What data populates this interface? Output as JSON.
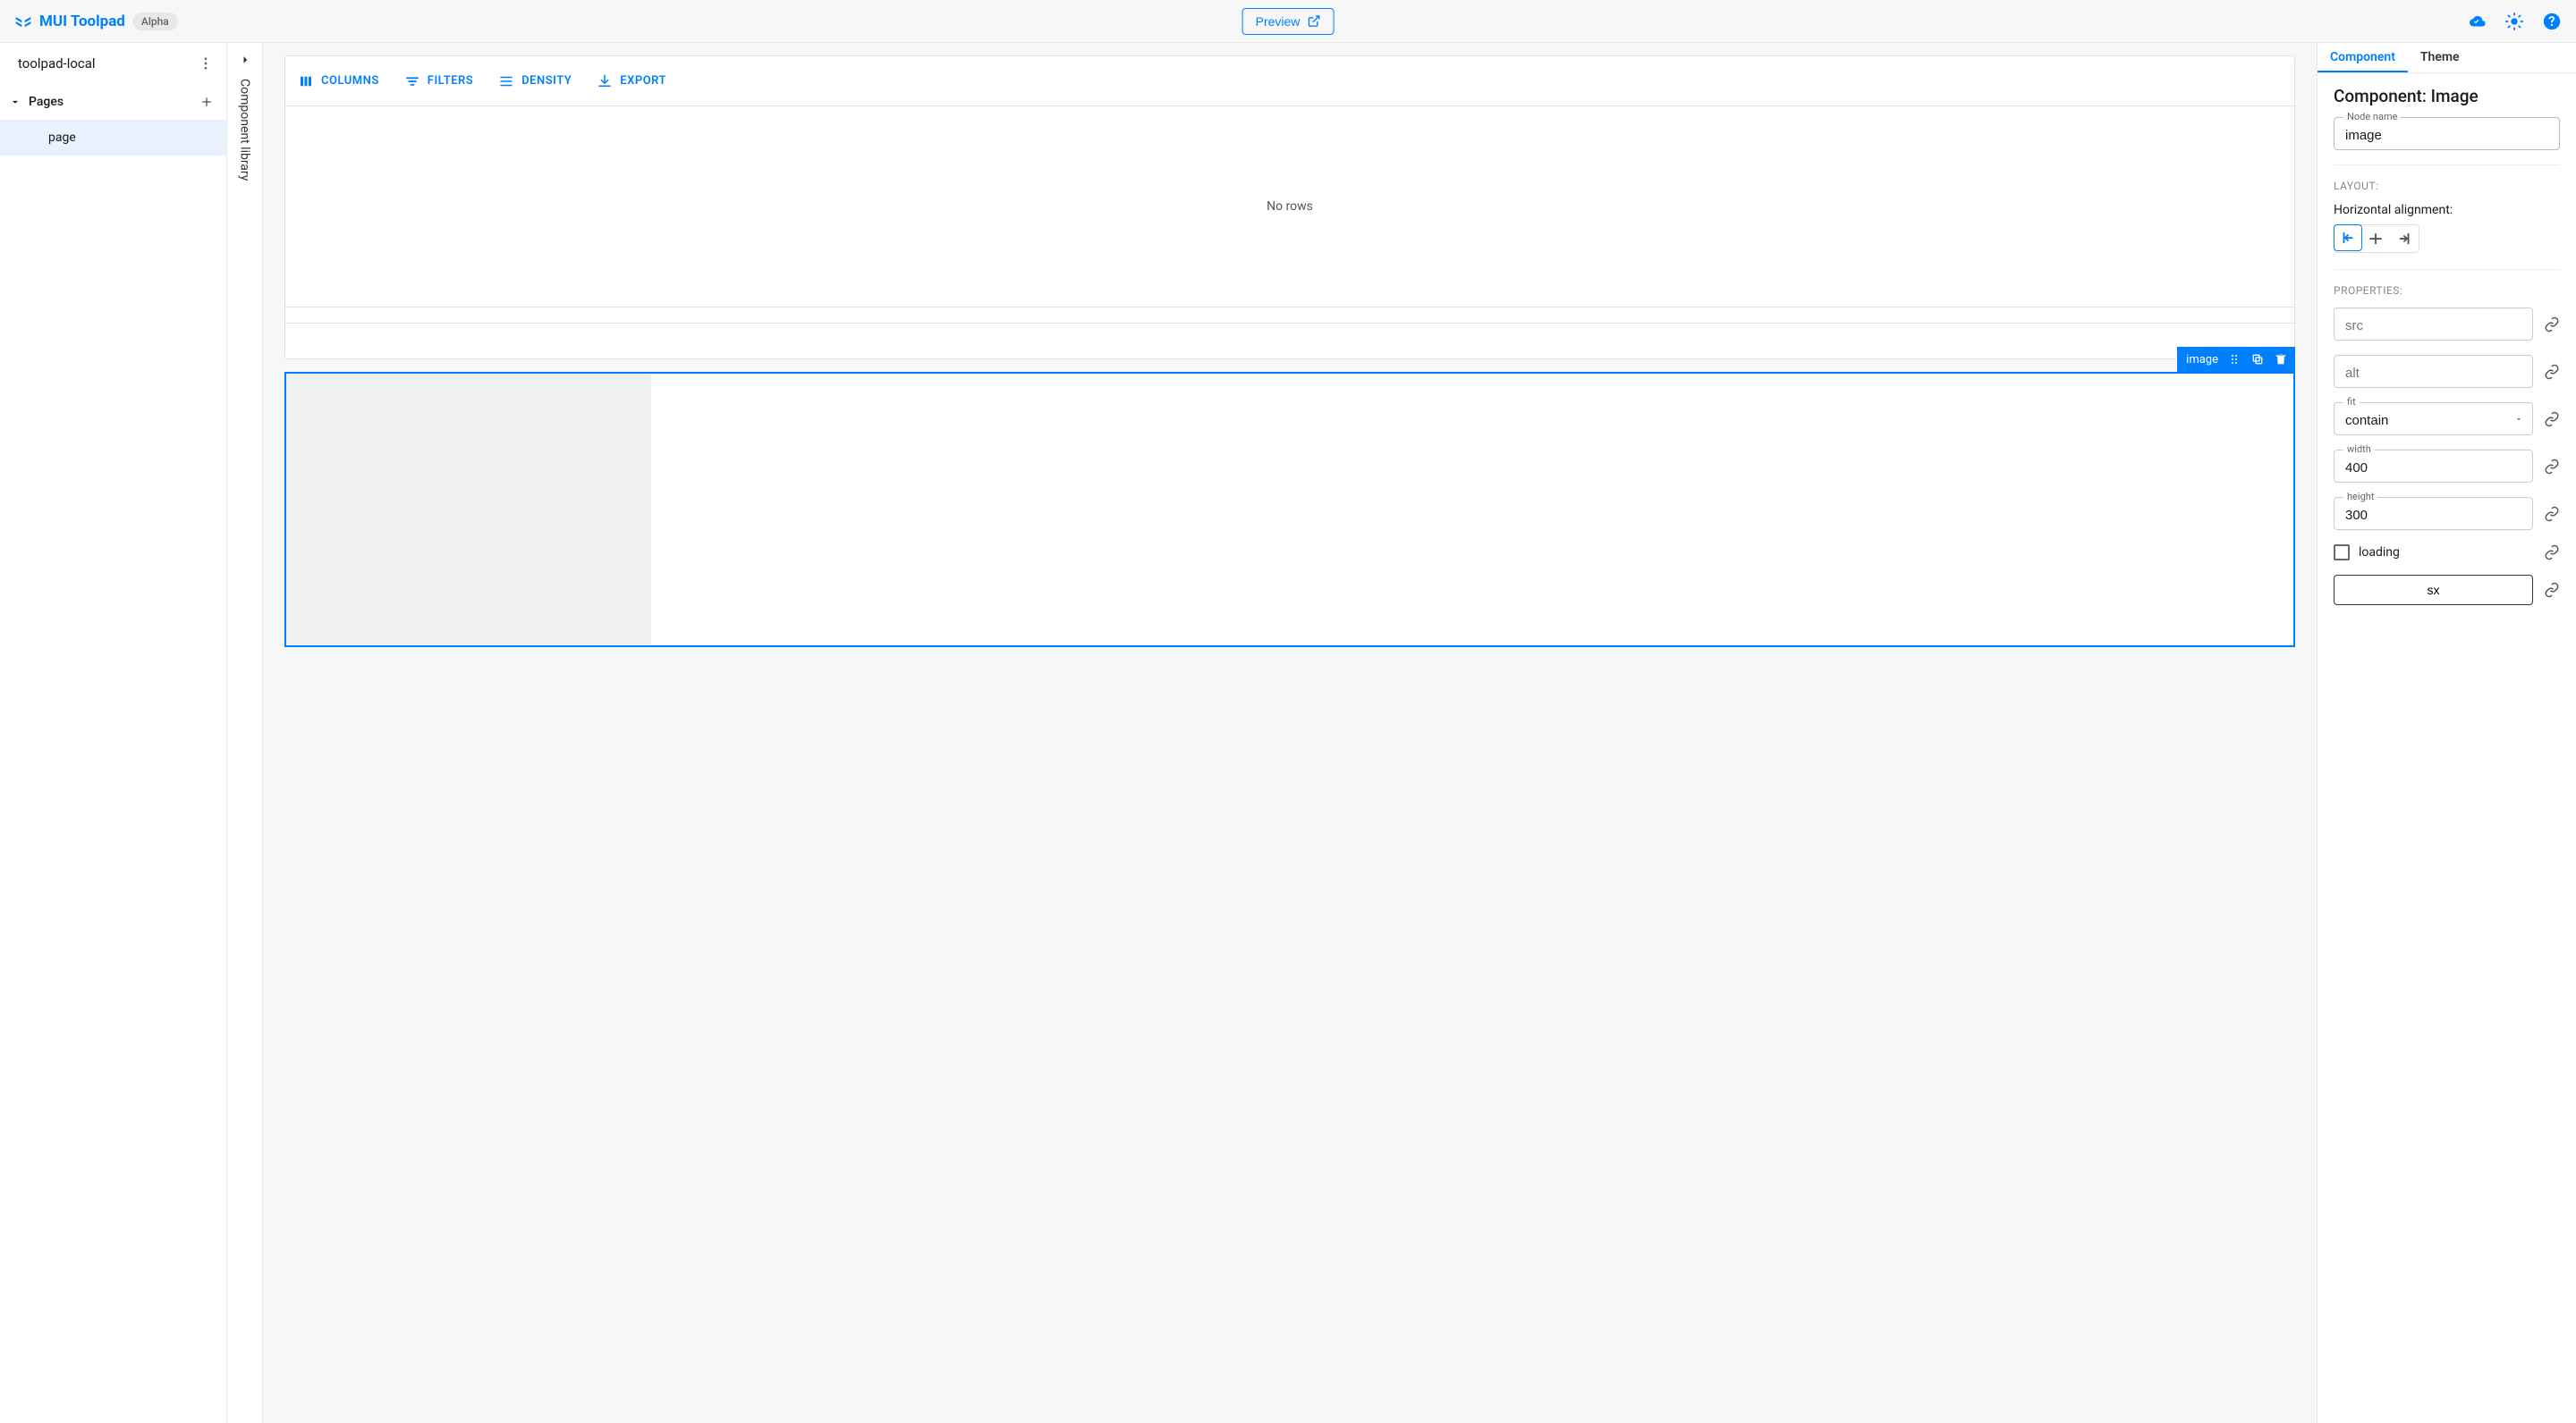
{
  "header": {
    "title": "MUI Toolpad",
    "badge": "Alpha",
    "preview_button": "Preview"
  },
  "sidebar": {
    "app_name": "toolpad-local",
    "groups": [
      {
        "label": "Pages",
        "items": [
          {
            "label": "page",
            "selected": true
          }
        ]
      }
    ]
  },
  "library_rail": {
    "label": "Component library"
  },
  "canvas": {
    "datagrid": {
      "toolbar": {
        "columns": "COLUMNS",
        "filters": "FILTERS",
        "density": "DENSITY",
        "export": "EXPORT"
      },
      "empty_text": "No rows"
    },
    "selected_component": {
      "label": "image"
    }
  },
  "inspector": {
    "tabs": {
      "component": "Component",
      "theme": "Theme"
    },
    "title": "Component: Image",
    "node_name_label": "Node name",
    "node_name_value": "image",
    "sections": {
      "layout": "LAYOUT:",
      "properties": "PROPERTIES:"
    },
    "layout": {
      "h_align_label": "Horizontal alignment:"
    },
    "properties": {
      "src": {
        "placeholder": "src",
        "value": ""
      },
      "alt": {
        "placeholder": "alt",
        "value": ""
      },
      "fit": {
        "label": "fit",
        "value": "contain"
      },
      "width": {
        "label": "width",
        "value": "400"
      },
      "height": {
        "label": "height",
        "value": "300"
      },
      "loading_label": "loading",
      "sx_button": "sx"
    }
  }
}
